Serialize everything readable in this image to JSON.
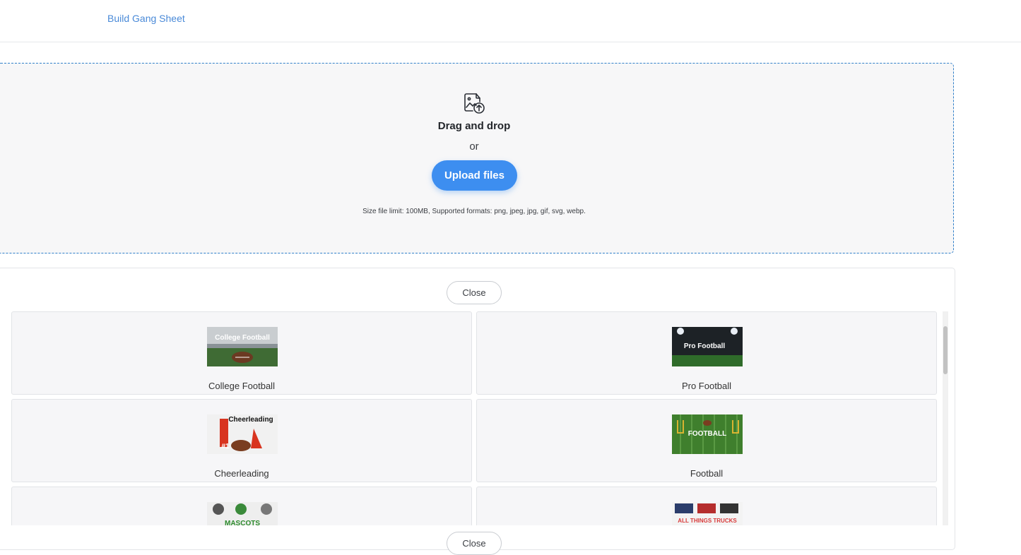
{
  "nav": {
    "build_gang_sheet": "Build Gang Sheet"
  },
  "dropzone": {
    "icon": "image-upload-icon",
    "title": "Drag and drop",
    "or": "or",
    "upload_label": "Upload files",
    "limits": "Size file limit: 100MB, Supported formats: png, jpeg, jpg, gif, svg, webp."
  },
  "panel": {
    "close_label": "Close",
    "categories": [
      {
        "label": "College Football",
        "thumb_text": "College Football"
      },
      {
        "label": "Pro Football",
        "thumb_text": "Pro Football"
      },
      {
        "label": "Cheerleading",
        "thumb_text": "Cheerleading"
      },
      {
        "label": "Football",
        "thumb_text": "FOOTBALL"
      },
      {
        "label": "",
        "thumb_text": "MASCOTS"
      },
      {
        "label": "",
        "thumb_text": "ALL THINGS TRUCKS"
      }
    ]
  },
  "colors": {
    "accent": "#3d8ef0",
    "link": "#4a8ad8",
    "dropzone_border": "#2f7fc9"
  }
}
